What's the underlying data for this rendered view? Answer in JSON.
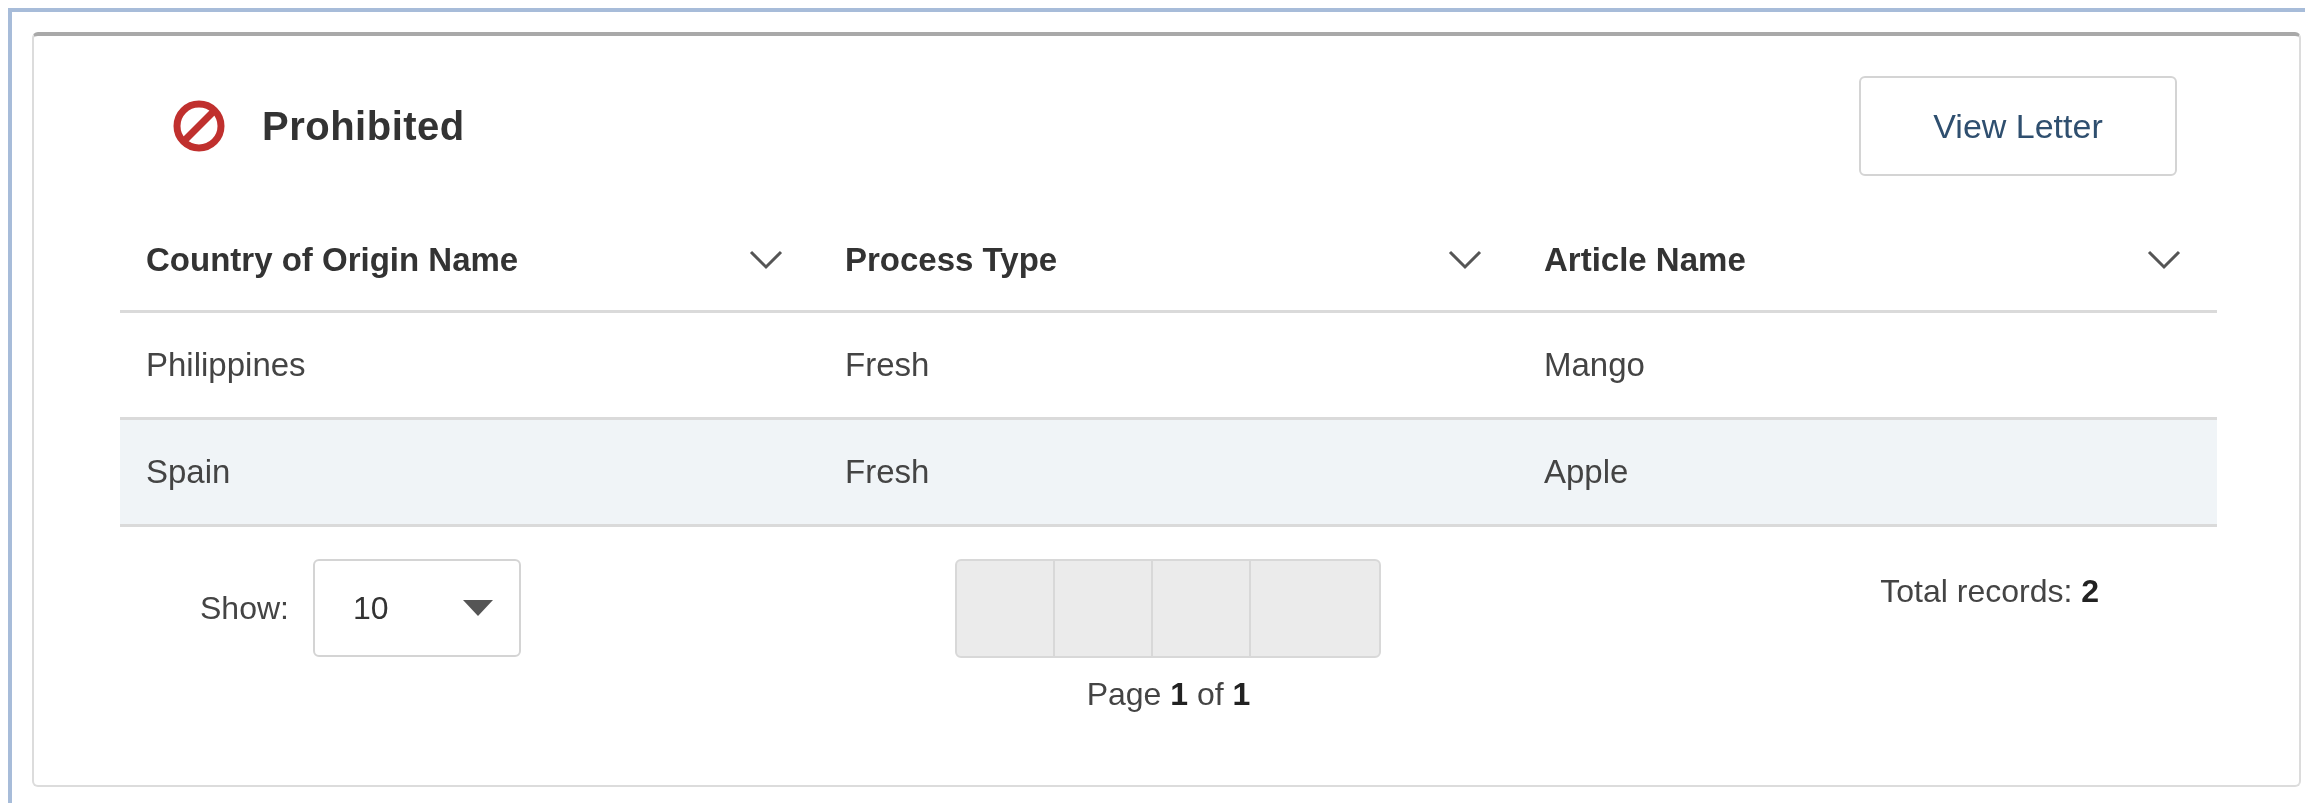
{
  "panel": {
    "title": "Prohibited",
    "button": "View Letter"
  },
  "table": {
    "columns": [
      {
        "label": "Country of Origin Name"
      },
      {
        "label": "Process Type"
      },
      {
        "label": "Article Name"
      }
    ],
    "rows": [
      {
        "cells": [
          "Philippines",
          "Fresh",
          "Mango"
        ],
        "selected": false
      },
      {
        "cells": [
          "Spain",
          "Fresh",
          "Apple"
        ],
        "selected": true
      }
    ]
  },
  "footer": {
    "show_label": "Show:",
    "page_size": "10",
    "page_info": "Page **1** of **1**",
    "total": "Total records: **2**"
  }
}
